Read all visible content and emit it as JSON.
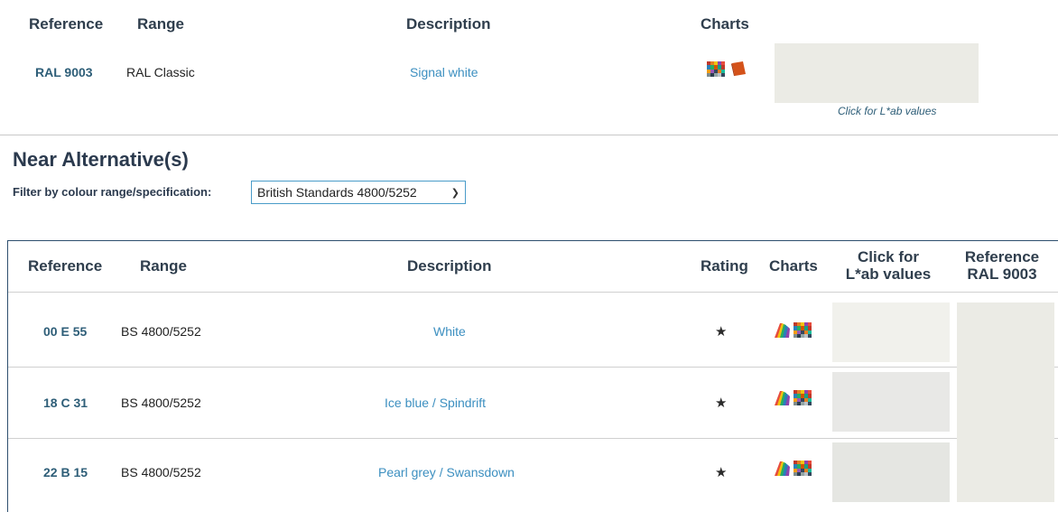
{
  "colors": {
    "heading": "#2f3e4d",
    "reference": "#2e5e78",
    "link": "#3c8fc0",
    "border": "#2e4f6e",
    "ral9003_swatch": "#ebebe5"
  },
  "top": {
    "headers": {
      "reference": "Reference",
      "range": "Range",
      "description": "Description",
      "charts": "Charts"
    },
    "row": {
      "reference": "RAL 9003",
      "range": "RAL Classic",
      "description": "Signal white",
      "charts_icons": [
        "colour-grid-icon",
        "colour-book-icon"
      ],
      "swatch_color": "#ebebe5"
    },
    "lab_link": "Click for L*ab values"
  },
  "section_title": "Near Alternative(s)",
  "filter": {
    "label": "Filter by colour range/specification:",
    "selected": "British Standards 4800/5252"
  },
  "alternatives": {
    "headers": {
      "reference": "Reference",
      "range": "Range",
      "description": "Description",
      "rating": "Rating",
      "charts": "Charts",
      "lab_line1": "Click for",
      "lab_line2": "L*ab values",
      "ref_line1": "Reference",
      "ref_line2": "RAL 9003"
    },
    "rows": [
      {
        "reference": "00 E 55",
        "range": "BS 4800/5252",
        "description": "White",
        "rating": "★",
        "swatch_color": "#f1f1ec"
      },
      {
        "reference": "18 C 31",
        "range": "BS 4800/5252",
        "description": "Ice blue / Spindrift",
        "rating": "★",
        "swatch_color": "#e8e8e6"
      },
      {
        "reference": "22 B 15",
        "range": "BS 4800/5252",
        "description": "Pearl grey / Swansdown",
        "rating": "★",
        "swatch_color": "#e5e6e2"
      }
    ],
    "charts_icons": [
      "colour-fan-icon",
      "colour-grid-icon"
    ],
    "reference_swatch_color": "#ebebe5"
  }
}
